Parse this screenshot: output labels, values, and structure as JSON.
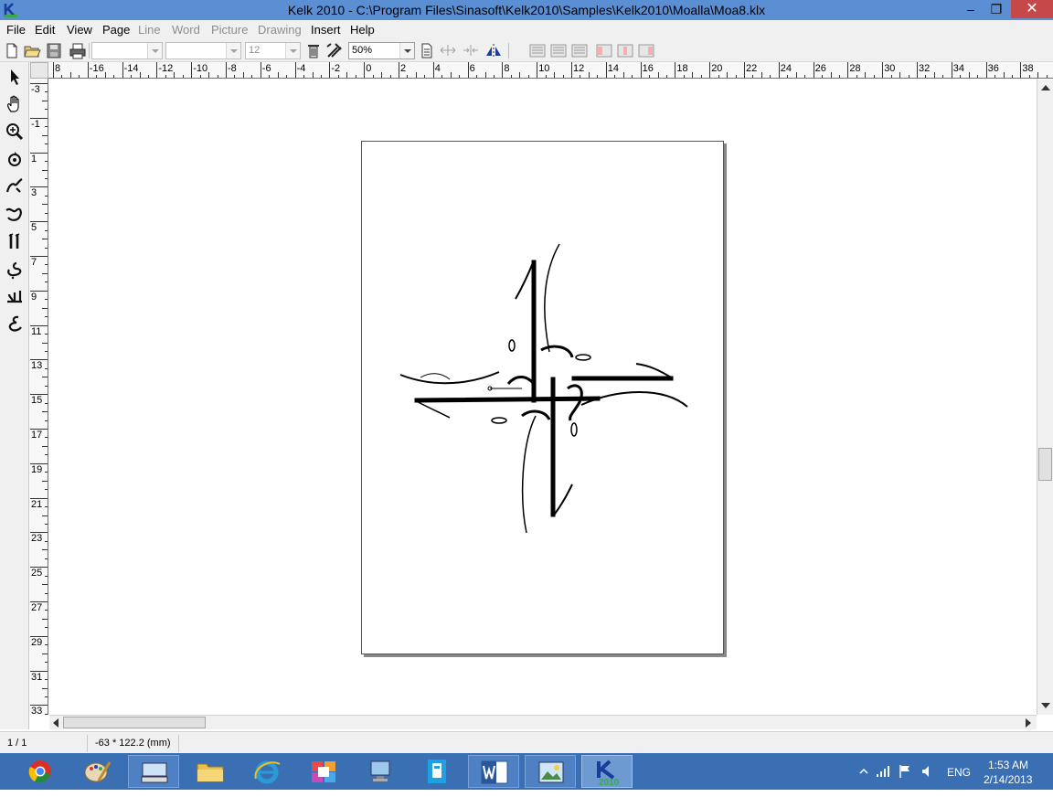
{
  "window": {
    "title": "Kelk 2010 - C:\\Program Files\\Sinasoft\\Kelk2010\\Samples\\Kelk2010\\Moalla\\Moa8.klx",
    "minimize": "–",
    "restore": "❐",
    "close": "✕"
  },
  "menu": {
    "file": "File",
    "edit": "Edit",
    "view": "View",
    "page": "Page",
    "line": "Line",
    "word": "Word",
    "picture": "Picture",
    "drawing": "Drawing",
    "insert": "Insert",
    "help": "Help"
  },
  "toolbar": {
    "font_name": "",
    "font_style": "",
    "font_size": "12",
    "zoom": "50%"
  },
  "rulers": {
    "horizontal_labels": [
      "8",
      "-16",
      "-14",
      "-12",
      "-10",
      "-8",
      "-6",
      "-4",
      "-2",
      "0",
      "2",
      "4",
      "6",
      "8",
      "10",
      "12",
      "14",
      "16",
      "18",
      "20",
      "22",
      "24",
      "26",
      "28",
      "30",
      "32",
      "34",
      "36",
      "38",
      "4"
    ],
    "vertical_labels": [
      "-3",
      "-1",
      "1",
      "3",
      "5",
      "7",
      "9",
      "11",
      "13",
      "15",
      "17",
      "19",
      "21",
      "23",
      "25",
      "27",
      "29",
      "31",
      "33"
    ]
  },
  "status": {
    "page": "1 / 1",
    "coords": "-63 * 122.2 (mm)"
  },
  "tray": {
    "language": "ENG",
    "time": "1:53 AM",
    "date": "2/14/2013"
  },
  "taskbar": {
    "kelk_badge": "2010"
  },
  "colors": {
    "titlebar": "#5a8fd4",
    "taskbar": "#3b6fb4",
    "close_button": "#c74848"
  }
}
